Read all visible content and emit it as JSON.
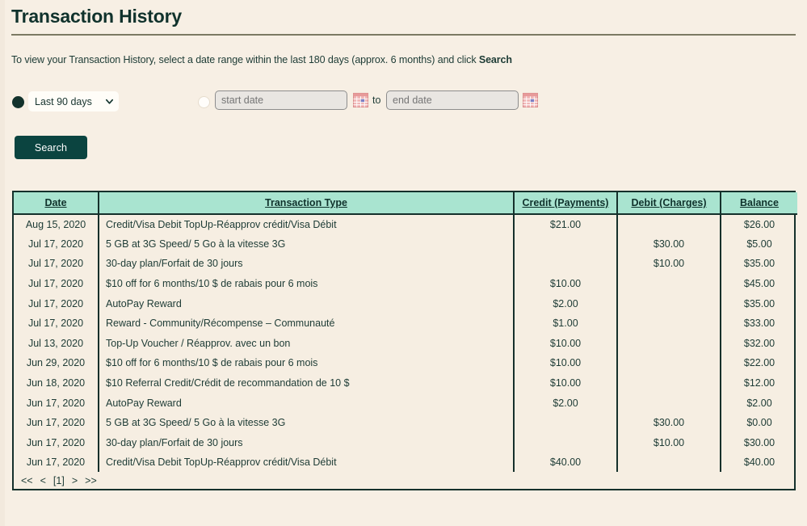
{
  "page": {
    "title": "Transaction History",
    "intro_prefix": "To view your Transaction History, select a date range within the last 180 days (approx. 6 months) and click ",
    "intro_emphasis": "Search"
  },
  "filters": {
    "preset_radio_selected": true,
    "preset_value": "Last 90 days",
    "preset_options": [
      "Last 90 days"
    ],
    "custom_radio_selected": false,
    "start_date_value": "",
    "start_date_placeholder": "start date",
    "to_label": "to",
    "end_date_value": "",
    "end_date_placeholder": "end date",
    "calendar_icon": "calendar-icon",
    "chevron_icon": "chevron-down-icon",
    "search_label": "Search"
  },
  "table": {
    "columns": [
      {
        "key": "date",
        "label": "Date"
      },
      {
        "key": "type",
        "label": "Transaction Type"
      },
      {
        "key": "credit",
        "label": "Credit (Payments)"
      },
      {
        "key": "debit",
        "label": "Debit (Charges)"
      },
      {
        "key": "balance",
        "label": "Balance"
      }
    ],
    "rows": [
      {
        "date": "Aug 15, 2020",
        "type": "Credit/Visa Debit TopUp-Réapprov crédit/Visa Débit",
        "credit": "$21.00",
        "debit": "",
        "balance": "$26.00"
      },
      {
        "date": "Jul 17, 2020",
        "type": "5 GB at 3G Speed/ 5 Go à la vitesse 3G",
        "credit": "",
        "debit": "$30.00",
        "balance": "$5.00"
      },
      {
        "date": "Jul 17, 2020",
        "type": "30-day plan/Forfait de 30 jours",
        "credit": "",
        "debit": "$10.00",
        "balance": "$35.00"
      },
      {
        "date": "Jul 17, 2020",
        "type": "$10 off for 6 months/10 $ de rabais pour 6 mois",
        "credit": "$10.00",
        "debit": "",
        "balance": "$45.00"
      },
      {
        "date": "Jul 17, 2020",
        "type": "AutoPay Reward",
        "credit": "$2.00",
        "debit": "",
        "balance": "$35.00"
      },
      {
        "date": "Jul 17, 2020",
        "type": "Reward - Community/Récompense – Communauté",
        "credit": "$1.00",
        "debit": "",
        "balance": "$33.00"
      },
      {
        "date": "Jul 13, 2020",
        "type": "Top-Up Voucher / Réapprov. avec un bon",
        "credit": "$10.00",
        "debit": "",
        "balance": "$32.00"
      },
      {
        "date": "Jun 29, 2020",
        "type": "$10 off for 6 months/10 $ de rabais pour 6 mois",
        "credit": "$10.00",
        "debit": "",
        "balance": "$22.00"
      },
      {
        "date": "Jun 18, 2020",
        "type": "$10 Referral Credit/Crédit de recommandation de 10 $",
        "credit": "$10.00",
        "debit": "",
        "balance": "$12.00"
      },
      {
        "date": "Jun 17, 2020",
        "type": "AutoPay Reward",
        "credit": "$2.00",
        "debit": "",
        "balance": "$2.00"
      },
      {
        "date": "Jun 17, 2020",
        "type": "5 GB at 3G Speed/ 5 Go à la vitesse 3G",
        "credit": "",
        "debit": "$30.00",
        "balance": "$0.00"
      },
      {
        "date": "Jun 17, 2020",
        "type": "30-day plan/Forfait de 30 jours",
        "credit": "",
        "debit": "$10.00",
        "balance": "$30.00"
      },
      {
        "date": "Jun 17, 2020",
        "type": "Credit/Visa Debit TopUp-Réapprov crédit/Visa Débit",
        "credit": "$40.00",
        "debit": "",
        "balance": "$40.00"
      }
    ]
  },
  "pager": {
    "first": "<<",
    "prev": "<",
    "current": "[1]",
    "next": ">",
    "last": ">>"
  },
  "colors": {
    "page_background": "#f7efe4",
    "table_header": "#a9e4d0",
    "border": "#15302b",
    "button": "#0b4440",
    "title_rule": "#7c7a63",
    "calendar_icon": "#e8a0a0"
  }
}
